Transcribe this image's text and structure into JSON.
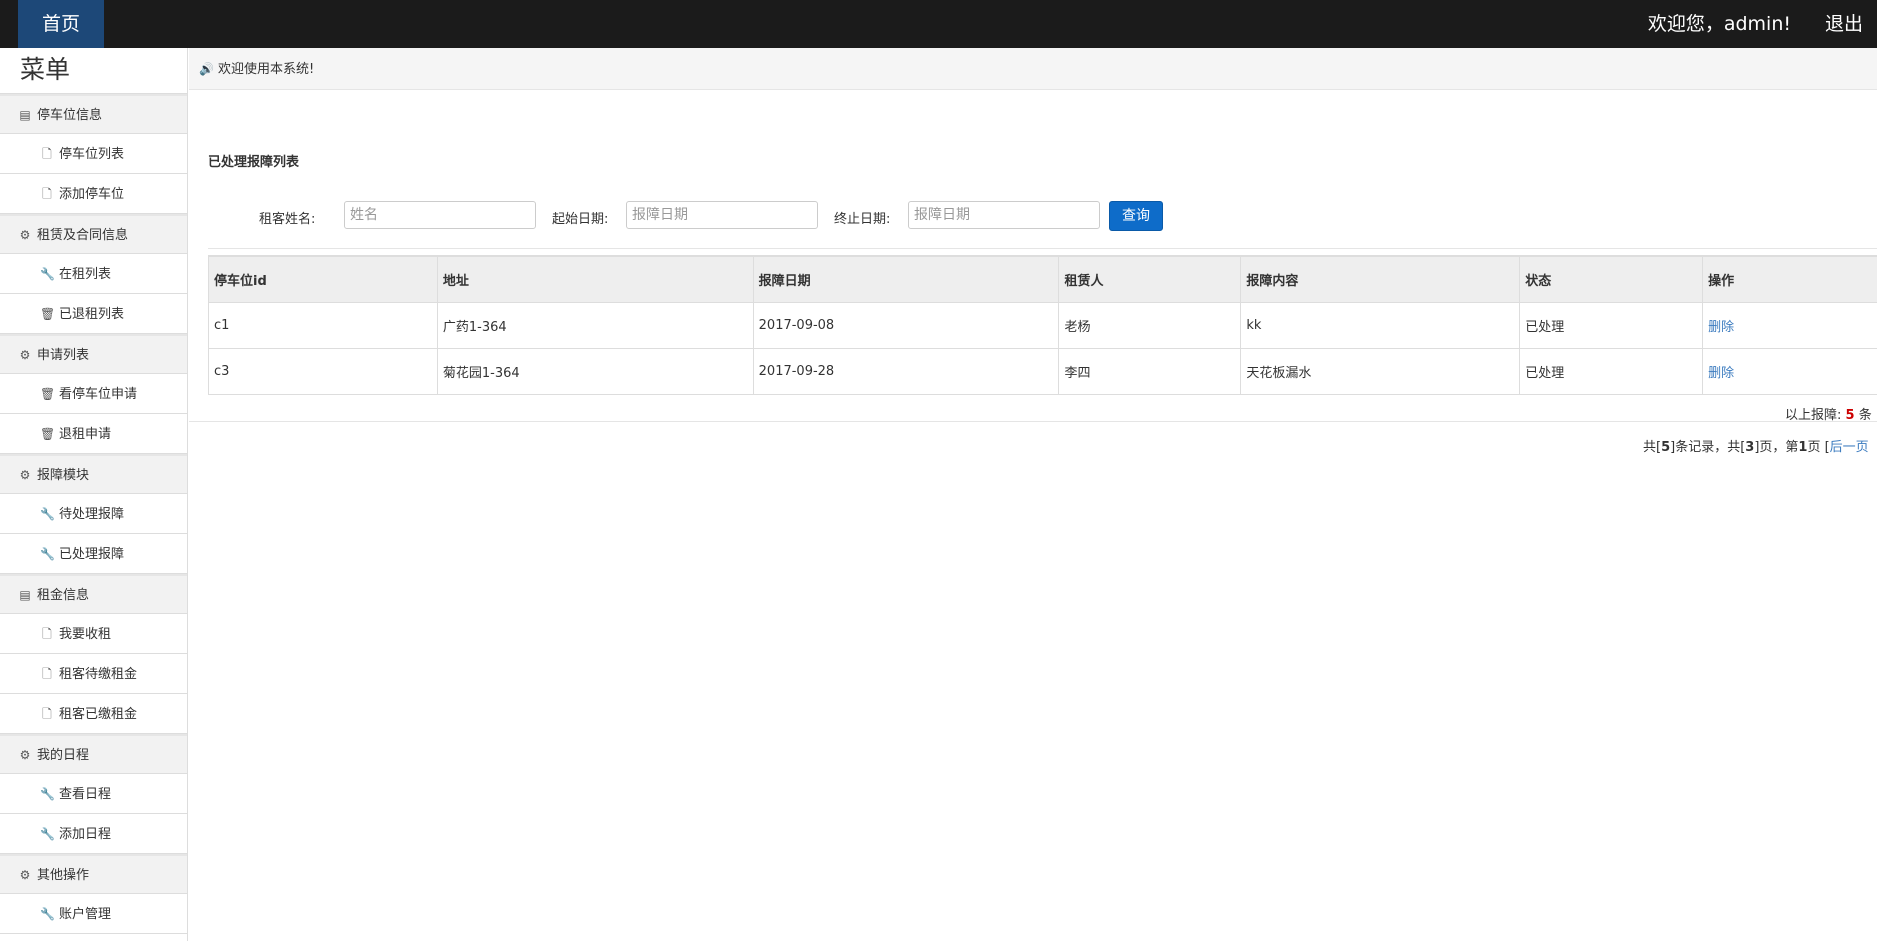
{
  "header": {
    "home_label": "首页",
    "welcome_text": "欢迎您，admin!",
    "logout_label": "退出"
  },
  "sidebar": {
    "title": "菜单",
    "groups": [
      {
        "label": "停车位信息",
        "icon": "list-alt-icon",
        "items": [
          {
            "label": "停车位列表",
            "icon": "file-icon"
          },
          {
            "label": "添加停车位",
            "icon": "file-icon"
          }
        ]
      },
      {
        "label": "租赁及合同信息",
        "icon": "cog-icon",
        "items": [
          {
            "label": "在租列表",
            "icon": "wrench-icon"
          },
          {
            "label": "已退租列表",
            "icon": "trash-icon"
          }
        ]
      },
      {
        "label": "申请列表",
        "icon": "cog-icon",
        "items": [
          {
            "label": "看停车位申请",
            "icon": "trash-icon"
          },
          {
            "label": "退租申请",
            "icon": "trash-icon"
          }
        ]
      },
      {
        "label": "报障模块",
        "icon": "cog-icon",
        "items": [
          {
            "label": "待处理报障",
            "icon": "wrench-icon"
          },
          {
            "label": "已处理报障",
            "icon": "wrench-icon"
          }
        ]
      },
      {
        "label": "租金信息",
        "icon": "list-alt-icon",
        "items": [
          {
            "label": "我要收租",
            "icon": "file-icon"
          },
          {
            "label": "租客待缴租金",
            "icon": "file-icon"
          },
          {
            "label": "租客已缴租金",
            "icon": "file-icon"
          }
        ]
      },
      {
        "label": "我的日程",
        "icon": "cog-icon",
        "items": [
          {
            "label": "查看日程",
            "icon": "wrench-icon"
          },
          {
            "label": "添加日程",
            "icon": "wrench-icon"
          }
        ]
      },
      {
        "label": "其他操作",
        "icon": "cog-icon",
        "items": [
          {
            "label": "账户管理",
            "icon": "wrench-icon"
          }
        ]
      }
    ]
  },
  "notice": {
    "icon": "volume-icon",
    "text": "欢迎使用本系统!"
  },
  "page": {
    "title": "已处理报障列表"
  },
  "search": {
    "tenant_label": "租客姓名:",
    "tenant_placeholder": "姓名",
    "start_label": "起始日期:",
    "start_placeholder": "报障日期",
    "end_label": "终止日期:",
    "end_placeholder": "报障日期",
    "submit_label": "查询"
  },
  "table": {
    "columns": [
      "停车位id",
      "地址",
      "报障日期",
      "租赁人",
      "报障内容",
      "状态",
      "操作"
    ],
    "rows": [
      [
        "c1",
        "广药1-364",
        "2017-09-08",
        "老杨",
        "kk",
        "已处理",
        "删除"
      ],
      [
        "c3",
        "菊花园1-364",
        "2017-09-28",
        "李四",
        "天花板漏水",
        "已处理",
        "删除"
      ]
    ]
  },
  "summary": {
    "prefix": "以上报障:",
    "count": "5",
    "suffix": "条"
  },
  "pagination": {
    "total_records": "5",
    "total_pages": "3",
    "current_page": "1",
    "t1": "共[",
    "t2": "]条记录，共[",
    "t3": "]页，第",
    "t4": "页 [",
    "next_label": "后一页"
  },
  "colors": {
    "topbar": "#1b1b1b",
    "home_tab": "#1d4878",
    "primary_button": "#0e6cc9",
    "link": "#3b7bbf",
    "count": "#cc0000"
  }
}
